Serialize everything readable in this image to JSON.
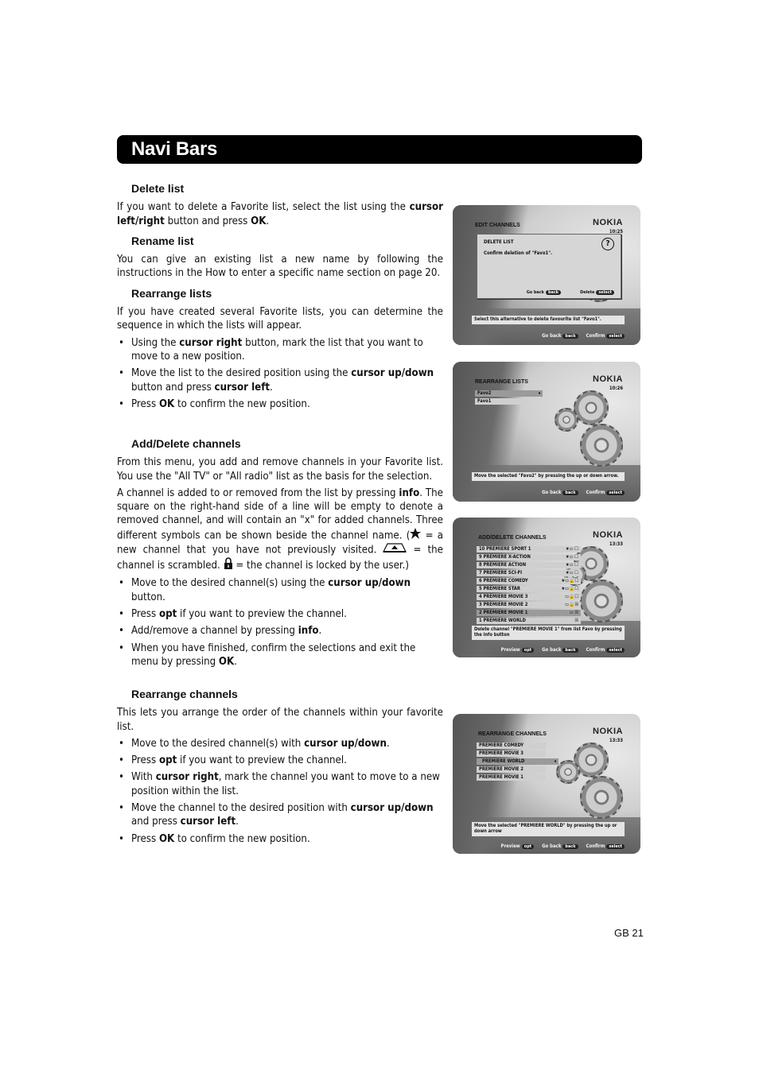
{
  "header": {
    "title": "Navi Bars"
  },
  "sections": {
    "delete_list": {
      "heading": "Delete list",
      "p1": [
        "If you want to delete a Favorite list, select the list using the ",
        "cursor left/right",
        " button and press ",
        "OK",
        "."
      ]
    },
    "rename_list": {
      "heading": "Rename list",
      "p1": "You can give an existing list a new name by following the instructions in the How to enter a specific name section on page 20."
    },
    "rearrange_lists": {
      "heading": "Rearrange lists",
      "p1": "If you have created several Favorite lists, you can determine the sequence in which the lists will appear.",
      "bullets": [
        [
          "Using the ",
          "cursor right",
          " button, mark the list that you want to move to a new position."
        ],
        [
          "Move the list to the desired position using the ",
          "cursor up/down",
          " button and press ",
          "cursor left",
          "."
        ],
        [
          "Press ",
          "OK",
          " to confirm the new position."
        ]
      ]
    },
    "add_delete": {
      "heading": "Add/Delete channels",
      "p1": "From this menu, you add and remove channels in your Favorite list. You use the \"All TV\" or \"All radio\" list as the basis for the selection.",
      "p2a": "A channel is added to or removed from the list by pressing ",
      "p2b": "info",
      "p2c": ". The square on the right-hand side of a line will be empty to denote a removed channel, and will contain an \"x\" for added channels. Three different symbols can be shown beside the channel name. (",
      "p2d": " = a new channel that you have not previously visited. ",
      "p2e": " = the channel is scrambled. ",
      "p2f": " = the channel is locked by the user.)",
      "bullets": [
        [
          "Move to the desired channel(s) using the ",
          "cursor up/down",
          " button."
        ],
        [
          "Press ",
          "opt",
          " if you want to preview the channel."
        ],
        [
          "Add/remove a channel by pressing ",
          "info",
          "."
        ],
        [
          "When you have finished, confirm the selections and exit the menu by pressing ",
          "OK",
          "."
        ]
      ]
    },
    "rearrange_channels": {
      "heading": "Rearrange channels",
      "p1": "This lets you arrange the order of the channels within your favorite list.",
      "bullets": [
        [
          "Move to the desired channel(s) with ",
          "cursor up/down",
          "."
        ],
        [
          "Press ",
          "opt",
          " if you want to preview the channel."
        ],
        [
          "With ",
          "cursor right",
          ", mark the channel you want to move to a new position within the list."
        ],
        [
          "Move the channel to the desired position with ",
          "cursor up/down",
          " and press ",
          "cursor left",
          "."
        ],
        [
          "Press ",
          "OK",
          " to confirm the new position."
        ]
      ]
    }
  },
  "screens": {
    "s1": {
      "logo": "NOKIA",
      "title": "EDIT CHANNELS",
      "time": "10:25",
      "dialog_title": "DELETE LIST",
      "dialog_msg": "Confirm deletion of \"Favo1\".",
      "dialog_back": "Go back",
      "dialog_back_key": "back",
      "dialog_delete": "Delete",
      "dialog_delete_key": "select",
      "hint": "Select this alternative to delete favourite list \"Favo1\".",
      "foot_back": "Go back",
      "foot_back_key": "back",
      "foot_confirm": "Confirm",
      "foot_confirm_key": "select"
    },
    "s2": {
      "logo": "NOKIA",
      "title": "REARRANGE LISTS",
      "time": "10:26",
      "rows": [
        "Favo2",
        "Favo1"
      ],
      "selected_marker": "◂",
      "hint": "Move the selected \"Favo2\" by pressing the up or down arrow.",
      "foot_back": "Go back",
      "foot_back_key": "back",
      "foot_confirm": "Confirm",
      "foot_confirm_key": "select"
    },
    "s3": {
      "logo": "NOKIA",
      "title": "ADD/DELETE CHANNELS",
      "time": "13:33",
      "rows": [
        {
          "name": "10 PREMIERE SPORT 1",
          "sym": "★▭ ☐"
        },
        {
          "name": "9 PREMIERE X-ACTION",
          "sym": "★▭ ☐"
        },
        {
          "name": "8 PREMIERE ACTION",
          "sym": "★▭ ☐"
        },
        {
          "name": "7 PREMIERE SCI-FI",
          "sym": "★▭ ☐"
        },
        {
          "name": "6 PREMIERE COMEDY",
          "sym": "★▭🔒☐"
        },
        {
          "name": "5 PREMIERE STAR",
          "sym": "★▭🔒☐"
        },
        {
          "name": "4 PREMIERE MOVIE 3",
          "sym": "▭🔒☐"
        },
        {
          "name": "3 PREMIERE MOVIE 2",
          "sym": "▭🔒☒"
        },
        {
          "name": "2 PREMIERE MOVIE 1",
          "sym": "▭ ☒"
        },
        {
          "name": "1 PREMIERE WORLD",
          "sym": "☒"
        }
      ],
      "hint": "Delete channel \"PREMIERE MOVIE 1\" from list Favo by pressing the info button",
      "foot_preview": "Preview",
      "foot_preview_key": "opt",
      "foot_back": "Go back",
      "foot_back_key": "back",
      "foot_confirm": "Confirm",
      "foot_confirm_key": "select"
    },
    "s4": {
      "logo": "NOKIA",
      "title": "REARRANGE CHANNELS",
      "time": "13:33",
      "rows": [
        "PREMIERE COMEDY",
        "PREMIERE MOVIE 3",
        "PREMIERE WORLD",
        "PREMIERE MOVIE 2",
        "PREMIERE MOVIE 1"
      ],
      "selected_marker": "◂",
      "hint": "Move the selected \"PREMIERE WORLD\" by pressing the up or down arrow",
      "foot_preview": "Preview",
      "foot_preview_key": "opt",
      "foot_back": "Go back",
      "foot_back_key": "back",
      "foot_confirm": "Confirm",
      "foot_confirm_key": "select"
    }
  },
  "footer": {
    "page_number": "GB 21"
  }
}
